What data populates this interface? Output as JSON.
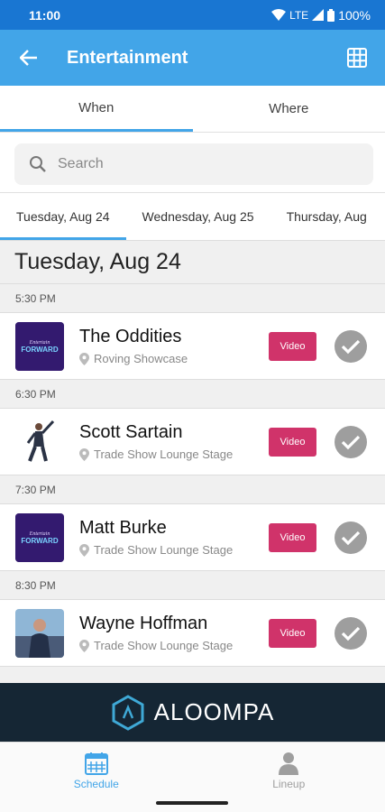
{
  "status_bar": {
    "time": "11:00",
    "network": "LTE",
    "battery": "100%"
  },
  "app_bar": {
    "title": "Entertainment",
    "back_icon": "arrow-back-icon",
    "grid_icon": "grid-icon"
  },
  "top_tabs": [
    {
      "label": "When",
      "active": true
    },
    {
      "label": "Where",
      "active": false
    }
  ],
  "search": {
    "placeholder": "Search"
  },
  "date_tabs": [
    {
      "label": "Tuesday, Aug 24",
      "active": true
    },
    {
      "label": "Wednesday, Aug 25",
      "active": false
    },
    {
      "label": "Thursday, Aug",
      "active": false
    }
  ],
  "day_header": "Tuesday, Aug 24",
  "schedule": [
    {
      "time": "5:30 PM",
      "title": "The Oddities",
      "location": "Roving Showcase",
      "video_label": "Video",
      "thumb": "forward-logo"
    },
    {
      "time": "6:30 PM",
      "title": "Scott Sartain",
      "location": "Trade Show Lounge Stage",
      "video_label": "Video",
      "thumb": "performer-photo"
    },
    {
      "time": "7:30 PM",
      "title": "Matt Burke",
      "location": "Trade Show Lounge Stage",
      "video_label": "Video",
      "thumb": "forward-logo"
    },
    {
      "time": "8:30 PM",
      "title": "Wayne Hoffman",
      "location": "Trade Show Lounge Stage",
      "video_label": "Video",
      "thumb": "performer-photo"
    }
  ],
  "banner": {
    "brand": "ALOOMPA"
  },
  "bottom_nav": [
    {
      "label": "Schedule",
      "icon": "calendar-icon",
      "active": true
    },
    {
      "label": "Lineup",
      "icon": "person-icon",
      "active": false
    }
  ],
  "colors": {
    "primary": "#42a5e8",
    "status": "#1976d2",
    "video": "#d0336a",
    "banner": "#152634"
  }
}
